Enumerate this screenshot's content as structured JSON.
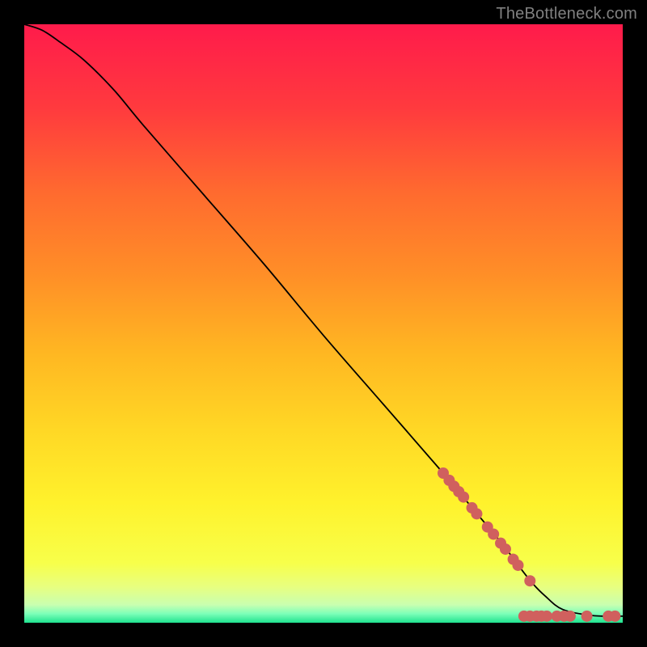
{
  "watermark": "TheBottleneck.com",
  "chart_data": {
    "type": "line",
    "title": "",
    "xlabel": "",
    "ylabel": "",
    "xlim": [
      0,
      100
    ],
    "ylim": [
      0,
      100
    ],
    "background_gradient": {
      "stops": [
        {
          "offset": 0.0,
          "color": "#ff1b4b"
        },
        {
          "offset": 0.14,
          "color": "#ff3a3e"
        },
        {
          "offset": 0.28,
          "color": "#ff6a2f"
        },
        {
          "offset": 0.42,
          "color": "#ff8f27"
        },
        {
          "offset": 0.55,
          "color": "#ffb722"
        },
        {
          "offset": 0.68,
          "color": "#ffd825"
        },
        {
          "offset": 0.8,
          "color": "#fff22c"
        },
        {
          "offset": 0.9,
          "color": "#f7ff4a"
        },
        {
          "offset": 0.94,
          "color": "#e8ff80"
        },
        {
          "offset": 0.97,
          "color": "#c9ffb0"
        },
        {
          "offset": 0.985,
          "color": "#7cffb8"
        },
        {
          "offset": 1.0,
          "color": "#1fe28f"
        }
      ]
    },
    "curve": {
      "name": "bottleneck-curve",
      "color": "#000000",
      "width": 1.8,
      "x": [
        0,
        3,
        6,
        10,
        15,
        20,
        30,
        40,
        50,
        60,
        70,
        75,
        80,
        83,
        85,
        87,
        90,
        95,
        100
      ],
      "y": [
        100,
        99,
        97,
        94,
        89,
        83,
        71.5,
        60,
        48,
        36.5,
        25,
        19,
        13,
        9,
        6.5,
        4.5,
        2.2,
        1.2,
        1.1
      ]
    },
    "markers": {
      "name": "highlight-points",
      "color": "#d0605e",
      "radius": 7,
      "points": [
        {
          "x": 70.0,
          "y": 25.0
        },
        {
          "x": 71.0,
          "y": 23.8
        },
        {
          "x": 71.8,
          "y": 22.8
        },
        {
          "x": 72.6,
          "y": 21.9
        },
        {
          "x": 73.4,
          "y": 21.0
        },
        {
          "x": 74.8,
          "y": 19.2
        },
        {
          "x": 75.6,
          "y": 18.2
        },
        {
          "x": 77.4,
          "y": 16.0
        },
        {
          "x": 78.4,
          "y": 14.8
        },
        {
          "x": 79.6,
          "y": 13.3
        },
        {
          "x": 80.4,
          "y": 12.3
        },
        {
          "x": 81.7,
          "y": 10.6
        },
        {
          "x": 82.5,
          "y": 9.6
        },
        {
          "x": 84.5,
          "y": 7.0
        },
        {
          "x": 83.5,
          "y": 1.1
        },
        {
          "x": 84.5,
          "y": 1.1
        },
        {
          "x": 85.6,
          "y": 1.1
        },
        {
          "x": 86.4,
          "y": 1.1
        },
        {
          "x": 87.3,
          "y": 1.1
        },
        {
          "x": 89.0,
          "y": 1.1
        },
        {
          "x": 90.2,
          "y": 1.1
        },
        {
          "x": 91.2,
          "y": 1.1
        },
        {
          "x": 94.0,
          "y": 1.1
        },
        {
          "x": 97.6,
          "y": 1.1
        },
        {
          "x": 98.7,
          "y": 1.1
        }
      ]
    }
  }
}
